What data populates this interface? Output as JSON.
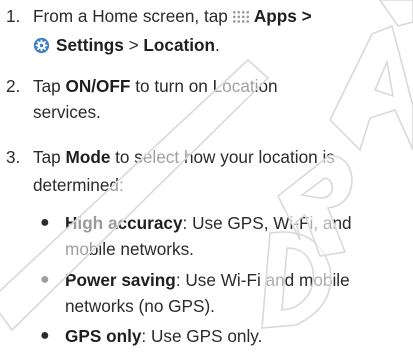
{
  "watermark": "DRAFT",
  "steps": [
    {
      "number": "1.",
      "line1": {
        "pre": "From a Home screen, tap",
        "apps_label": "Apps",
        "sep1": ">"
      },
      "line2": {
        "settings_label": "Settings",
        "sep2": ">",
        "location_label": "Location",
        "end": "."
      },
      "icons": [
        "apps-grid-icon",
        "settings-gear-icon"
      ]
    },
    {
      "number": "2.",
      "line1": {
        "pre": "Tap",
        "onoff_label": "ON/OFF",
        "post": "to turn on Location"
      },
      "line2": "services."
    },
    {
      "number": "3.",
      "line1": {
        "pre": "Tap",
        "mode_label": "Mode",
        "post": "to select how your location is"
      },
      "line2": "determined:",
      "options": [
        {
          "name": "High accuracy",
          "desc_line1": ": Use GPS, Wi-Fi, and",
          "desc_line2": "mobile networks."
        },
        {
          "name": "Power saving",
          "desc_line1": ": Use Wi-Fi and mobile",
          "desc_line2": "networks (no GPS)."
        },
        {
          "name": "GPS only",
          "desc_line1": ": Use GPS only."
        }
      ]
    }
  ],
  "colors": {
    "text": "#2b2b2b",
    "watermark": "#d9d9d9",
    "icon_blue": "#3d7ec4"
  }
}
